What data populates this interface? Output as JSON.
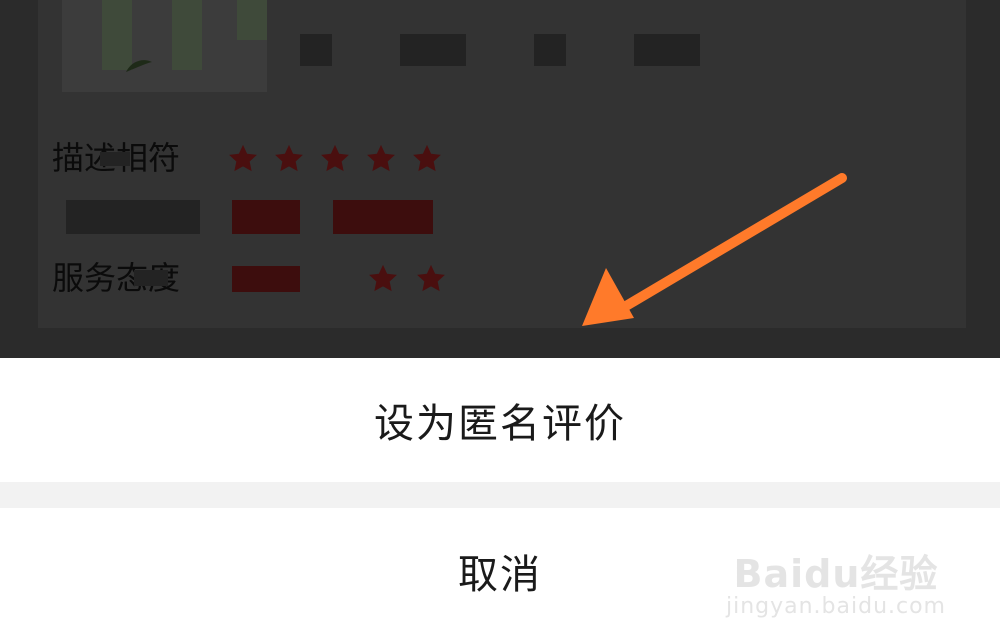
{
  "review": {
    "rows": [
      {
        "label": "描述相符",
        "stars": 5
      },
      {
        "label": "",
        "stars": 0
      },
      {
        "label": "服务态度",
        "stars": 5
      }
    ]
  },
  "action_sheet": {
    "anonymous_label": "设为匿名评价",
    "cancel_label": "取消"
  },
  "watermark": {
    "logo_text": "Baidu经验",
    "url": "jingyan.baidu.com"
  },
  "colors": {
    "overlay": "#2b2b2b",
    "arrow": "#ff7a2a",
    "sheet_bg": "#ffffff",
    "sheet_gap": "#f2f2f2"
  }
}
